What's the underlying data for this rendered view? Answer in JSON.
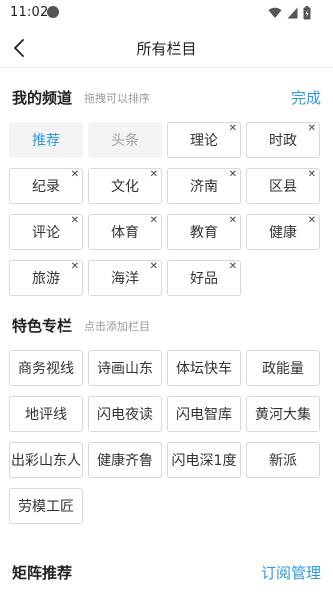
{
  "status_bar": {
    "time": "11:02"
  },
  "header": {
    "title": "所有栏目",
    "back_icon": "chevron-left-icon"
  },
  "my_channels": {
    "title": "我的频道",
    "hint": "拖拽可以排序",
    "action": "完成",
    "fixed": [
      "推荐",
      "头条"
    ],
    "items": [
      "理论",
      "时政",
      "纪录",
      "文化",
      "济南",
      "区县",
      "评论",
      "体育",
      "教育",
      "健康",
      "旅游",
      "海洋",
      "好品"
    ]
  },
  "featured": {
    "title": "特色专栏",
    "hint": "点击添加栏目",
    "items": [
      "商务视线",
      "诗画山东",
      "体坛快车",
      "政能量",
      "地评线",
      "闪电夜读",
      "闪电智库",
      "黄河大集",
      "出彩山东人",
      "健康齐鲁",
      "闪电深1度",
      "新派",
      "劳模工匠"
    ]
  },
  "matrix": {
    "title": "矩阵推荐",
    "action": "订阅管理"
  },
  "colors": {
    "accent": "#2b9be6",
    "chip_border": "#d9d9d9",
    "fixed_bg": "#f4f4f4"
  }
}
